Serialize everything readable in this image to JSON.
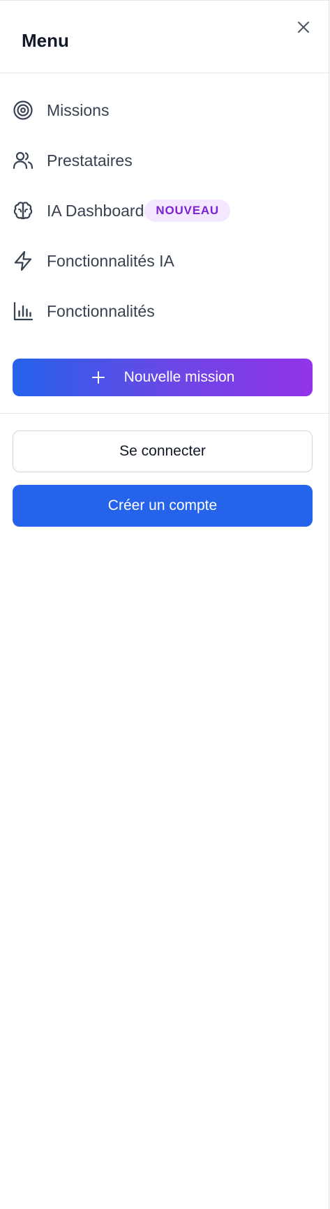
{
  "menu": {
    "title": "Menu",
    "close_icon": "close-icon"
  },
  "nav": {
    "items": [
      {
        "label": "Missions",
        "icon": "target-icon"
      },
      {
        "label": "Prestataires",
        "icon": "users-icon"
      },
      {
        "label": "IA Dashboard",
        "icon": "brain-icon",
        "badge": "NOUVEAU"
      },
      {
        "label": "Fonctionnalités IA",
        "icon": "lightning-icon"
      },
      {
        "label": "Fonctionnalités",
        "icon": "bar-chart-icon"
      }
    ]
  },
  "actions": {
    "new_mission_label": "Nouvelle mission",
    "new_mission_icon": "plus-icon",
    "login_label": "Se connecter",
    "signup_label": "Créer un compte"
  },
  "colors": {
    "primary_blue": "#2563eb",
    "gradient_end_purple": "#9333ea",
    "badge_bg": "#f3e8ff",
    "badge_text": "#7e22ce",
    "text_primary": "#111827",
    "text_nav": "#374151",
    "border": "#e5e7eb"
  }
}
